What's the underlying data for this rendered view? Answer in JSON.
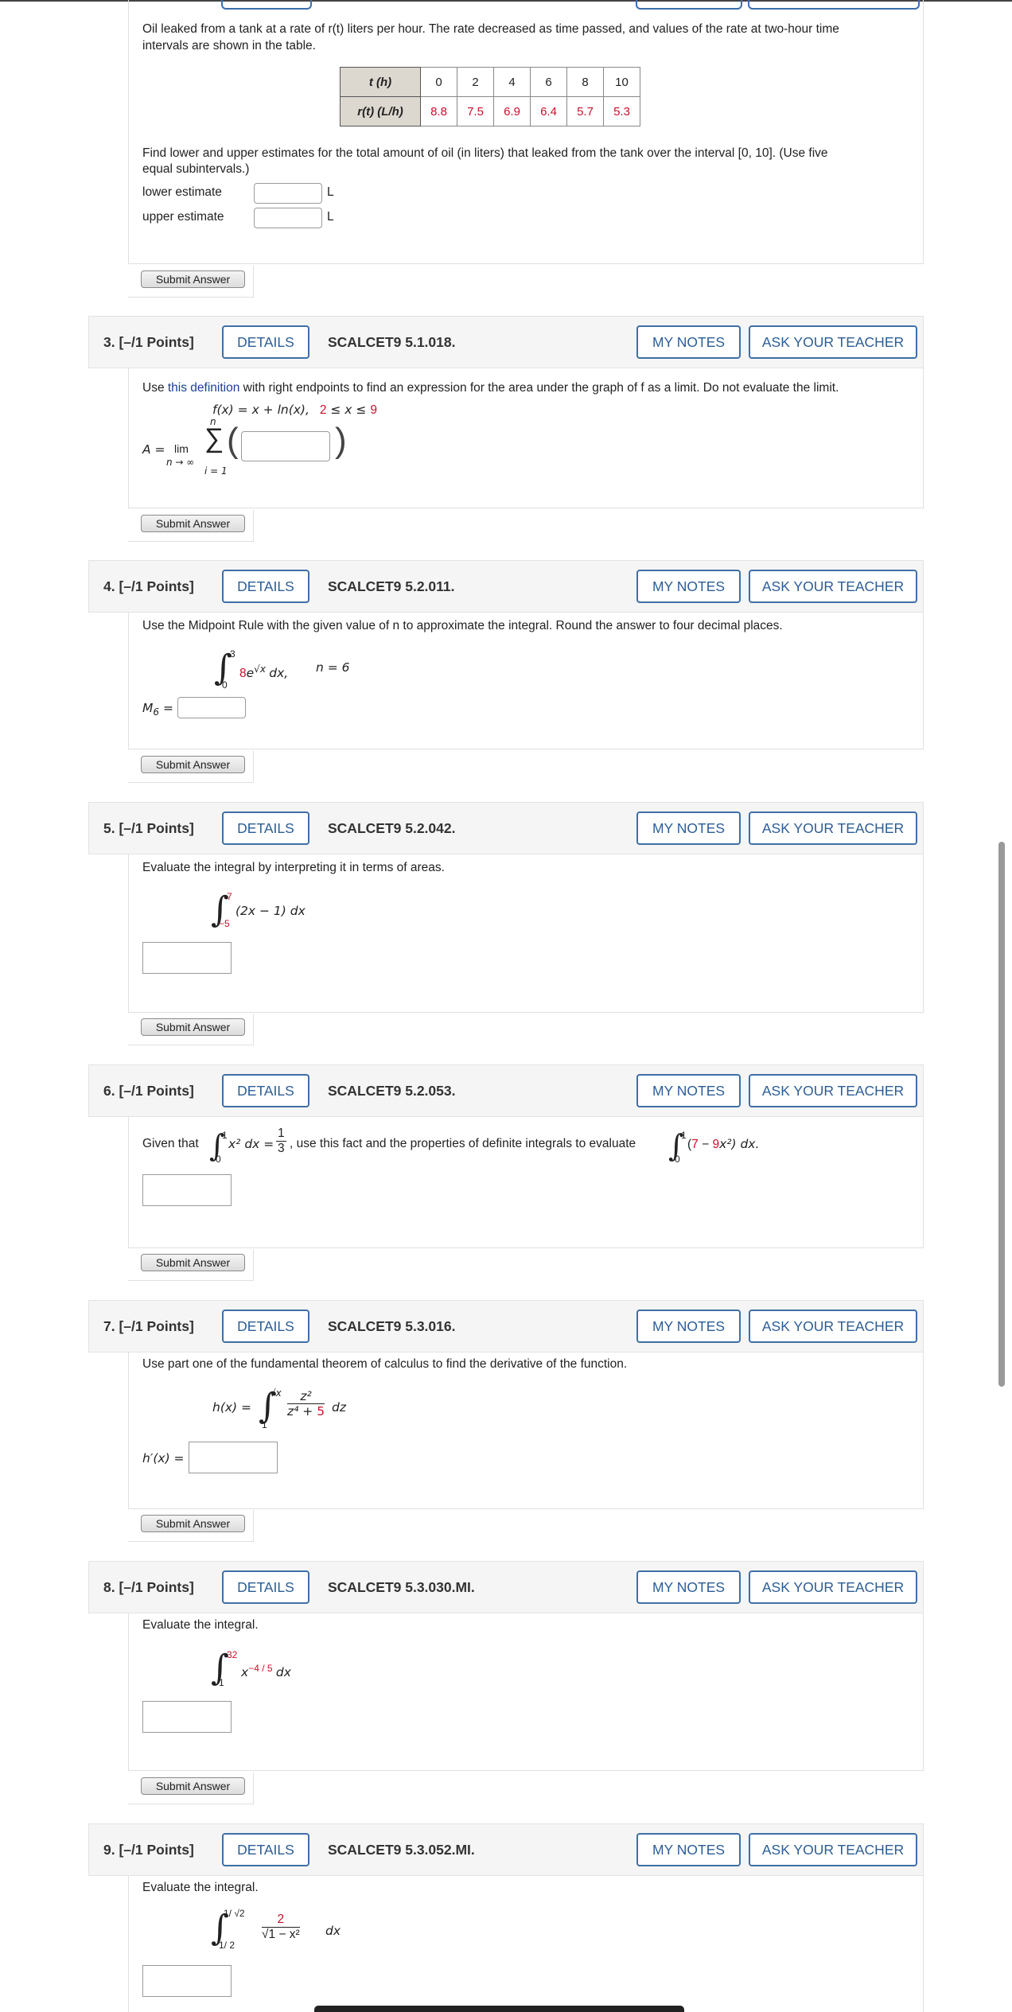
{
  "q2": {
    "text_line1": "Oil leaked from a tank at a rate of r(t) liters per hour. The rate decreased as time passed, and values of the rate at two-hour time",
    "text_line2": "intervals are shown in the table.",
    "table": {
      "row1_header": "t (h)",
      "row2_header": "r(t) (L/h)",
      "t_values": [
        "0",
        "2",
        "4",
        "6",
        "8",
        "10"
      ],
      "r_values": [
        "8.8",
        "7.5",
        "6.9",
        "6.4",
        "5.7",
        "5.3"
      ]
    },
    "find_line1": "Find lower and upper estimates for the total amount of oil (in liters) that leaked from the tank over the interval [0, 10]. (Use five",
    "find_line2": "equal subintervals.)",
    "lower_label": "lower estimate",
    "upper_label": "upper estimate",
    "unit": "L",
    "submit": "Submit Answer"
  },
  "questions": [
    {
      "num": "3.",
      "points": "[–/1 Points]",
      "code": "SCALCET9 5.1.018."
    },
    {
      "num": "4.",
      "points": "[–/1 Points]",
      "code": "SCALCET9 5.2.011."
    },
    {
      "num": "5.",
      "points": "[–/1 Points]",
      "code": "SCALCET9 5.2.042."
    },
    {
      "num": "6.",
      "points": "[–/1 Points]",
      "code": "SCALCET9 5.2.053."
    },
    {
      "num": "7.",
      "points": "[–/1 Points]",
      "code": "SCALCET9 5.3.016."
    },
    {
      "num": "8.",
      "points": "[–/1 Points]",
      "code": "SCALCET9 5.3.030.MI."
    },
    {
      "num": "9.",
      "points": "[–/1 Points]",
      "code": "SCALCET9 5.3.052.MI."
    }
  ],
  "buttons": {
    "details": "DETAILS",
    "my_notes": "MY NOTES",
    "ask_teacher": "ASK YOUR TEACHER",
    "submit": "Submit Answer"
  },
  "q3": {
    "text_pre": "Use ",
    "link": "this definition",
    "text_post": " with right endpoints to find an expression for the area under the graph of f as a limit. Do not evaluate the limit.",
    "fx": "f(x) = x + ln(x),",
    "interval_a": "2",
    "interval_mid": " ≤ x ≤ ",
    "interval_b": "9",
    "A_eq": "A =",
    "lim": "lim",
    "lim_sub": "n → ∞",
    "sum_top": "n",
    "sum_bot": "i = 1"
  },
  "q4": {
    "text": "Use the Midpoint Rule with the given value of n to approximate the integral. Round the answer to four decimal places.",
    "upper": "3",
    "lower": "0",
    "coef": "8",
    "integrand": "e",
    "exp": "√x",
    "dx": "dx,",
    "n_eq": "n = 6",
    "m_label": "M",
    "m_sub": "6",
    "eq": "="
  },
  "q5": {
    "text": "Evaluate the integral by interpreting it in terms of areas.",
    "upper": "7",
    "lower": "−5",
    "integrand": "(2x − 1) dx"
  },
  "q6": {
    "given": "Given that",
    "upper": "1",
    "lower": "0",
    "x2dx": "x² dx =",
    "num": "1",
    "den": "3",
    "mid": ", use this fact and the properties of definite integrals to evaluate",
    "upper2": "1",
    "lower2": "0",
    "open": "(",
    "seven": "7",
    "minus": " − ",
    "nine": "9",
    "x2": "x²",
    "close": ") dx."
  },
  "q7": {
    "text": "Use part one of the fundamental theorem of calculus to find the derivative of the function.",
    "hx": "h(x) =",
    "upper": "√x",
    "lower": "1",
    "num": "z²",
    "den_a": "z⁴ + ",
    "den_b": "5",
    "dz": "dz",
    "hprime": "h′(x) ="
  },
  "q8": {
    "text": "Evaluate the integral.",
    "upper": "32",
    "lower": "1",
    "x": "x",
    "exp": "−4 / 5",
    "dx": "dx"
  },
  "q9": {
    "text": "Evaluate the integral.",
    "upper": "1/ √2",
    "lower": "1/ 2",
    "num": "2",
    "den": "√1 − x²",
    "dx": "dx"
  }
}
